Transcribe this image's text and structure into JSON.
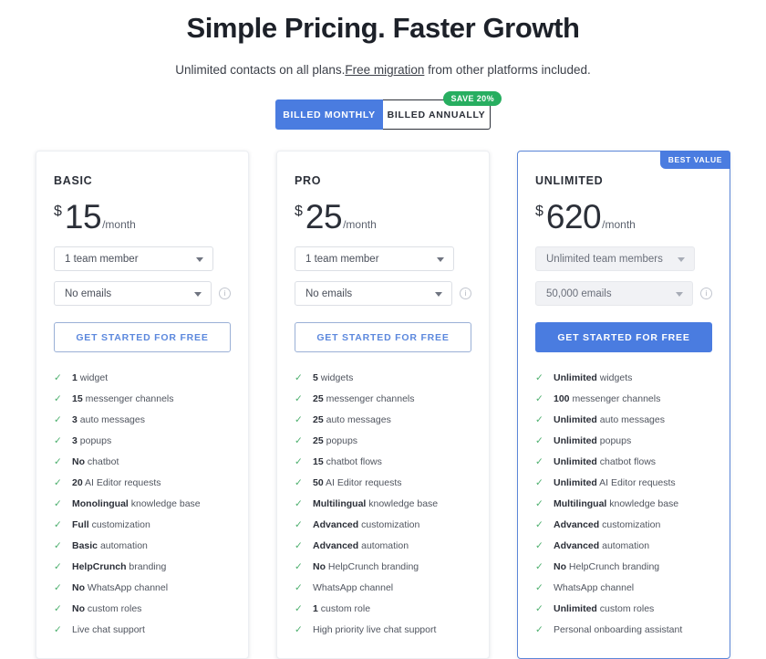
{
  "header": {
    "headline": "Simple Pricing. Faster Growth",
    "subhead_before": "Unlimited contacts on all plans.",
    "subhead_link": "Free migration",
    "subhead_after": " from other platforms included."
  },
  "billing_toggle": {
    "monthly_label": "BILLED MONTHLY",
    "annually_label": "BILLED ANNUALLY",
    "save_badge": "SAVE 20%",
    "selected": "BILLED MONTHLY",
    "active_color": "#4a7ce0",
    "badge_color": "#27ae60"
  },
  "plans": [
    {
      "name": "BASIC",
      "currency": "$",
      "amount": "15",
      "period": "/month",
      "team_select": "1 team member",
      "emails_select": "No emails",
      "info_icon": "info-icon",
      "cta_label": "GET STARTED FOR FREE",
      "features": [
        {
          "strong": "1",
          "text": " widget"
        },
        {
          "strong": "15",
          "text": " messenger channels"
        },
        {
          "strong": "3",
          "text": " auto messages"
        },
        {
          "strong": "3",
          "text": " popups"
        },
        {
          "strong": "No",
          "text": " chatbot"
        },
        {
          "strong": "20",
          "text": " AI Editor requests"
        },
        {
          "strong": "Monolingual",
          "text": " knowledge base"
        },
        {
          "strong": "Full",
          "text": " customization"
        },
        {
          "strong": "Basic",
          "text": " automation"
        },
        {
          "strong": "HelpCrunch",
          "text": " branding"
        },
        {
          "strong": "No",
          "text": " WhatsApp channel"
        },
        {
          "strong": "No",
          "text": " custom roles"
        },
        {
          "strong": "",
          "text": "Live chat support"
        }
      ]
    },
    {
      "name": "PRO",
      "currency": "$",
      "amount": "25",
      "period": "/month",
      "team_select": "1 team member",
      "emails_select": "No emails",
      "info_icon": "info-icon",
      "cta_label": "GET STARTED FOR FREE",
      "features": [
        {
          "strong": "5",
          "text": " widgets"
        },
        {
          "strong": "25",
          "text": " messenger channels"
        },
        {
          "strong": "25",
          "text": " auto messages"
        },
        {
          "strong": "25",
          "text": " popups"
        },
        {
          "strong": "15",
          "text": " chatbot flows"
        },
        {
          "strong": "50",
          "text": " AI Editor requests"
        },
        {
          "strong": "Multilingual",
          "text": " knowledge base"
        },
        {
          "strong": "Advanced",
          "text": " customization"
        },
        {
          "strong": "Advanced",
          "text": " automation"
        },
        {
          "strong": "No",
          "text": " HelpCrunch branding"
        },
        {
          "strong": "",
          "text": "WhatsApp channel"
        },
        {
          "strong": "1",
          "text": " custom role"
        },
        {
          "strong": "",
          "text": "High priority live chat support"
        }
      ]
    },
    {
      "name": "UNLIMITED",
      "badge": "BEST VALUE",
      "currency": "$",
      "amount": "620",
      "period": "/month",
      "team_select": "Unlimited team members",
      "emails_select": "50,000 emails",
      "info_icon": "info-icon",
      "cta_label": "GET STARTED FOR FREE",
      "features": [
        {
          "strong": "Unlimited",
          "text": " widgets"
        },
        {
          "strong": "100",
          "text": " messenger channels"
        },
        {
          "strong": "Unlimited",
          "text": " auto messages"
        },
        {
          "strong": "Unlimited",
          "text": " popups"
        },
        {
          "strong": "Unlimited",
          "text": " chatbot flows"
        },
        {
          "strong": "Unlimited",
          "text": " AI Editor requests"
        },
        {
          "strong": "Multilingual",
          "text": " knowledge base"
        },
        {
          "strong": "Advanced",
          "text": " customization"
        },
        {
          "strong": "Advanced",
          "text": " automation"
        },
        {
          "strong": "No",
          "text": " HelpCrunch branding"
        },
        {
          "strong": "",
          "text": "WhatsApp channel"
        },
        {
          "strong": "Unlimited",
          "text": " custom roles"
        },
        {
          "strong": "",
          "text": "Personal onboarding assistant"
        }
      ]
    }
  ]
}
